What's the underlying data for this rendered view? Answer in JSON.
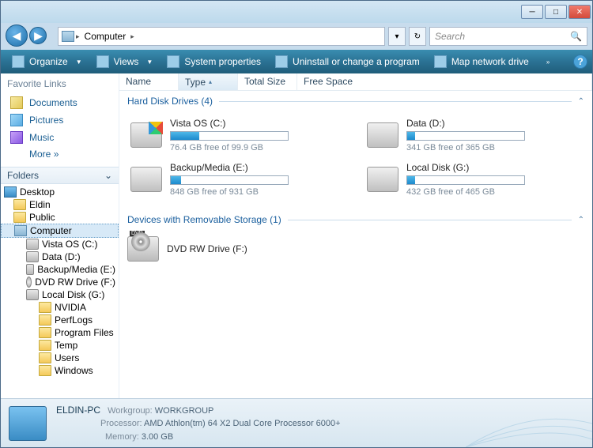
{
  "search": {
    "placeholder": "Search"
  },
  "breadcrumb": {
    "root_icon": "computer-icon",
    "items": [
      "Computer"
    ]
  },
  "toolbar": {
    "organize": "Organize",
    "views": "Views",
    "sys_props": "System properties",
    "uninstall": "Uninstall or change a program",
    "map_drive": "Map network drive"
  },
  "sidebar": {
    "fav_title": "Favorite Links",
    "favorites": [
      {
        "label": "Documents",
        "icon": "fav-docs"
      },
      {
        "label": "Pictures",
        "icon": "fav-pics"
      },
      {
        "label": "Music",
        "icon": "fav-music"
      }
    ],
    "more": "More",
    "folders_title": "Folders",
    "tree": [
      {
        "label": "Desktop",
        "icon": "ico-desktop",
        "indent": 0
      },
      {
        "label": "Eldin",
        "icon": "ico-folder",
        "indent": 1
      },
      {
        "label": "Public",
        "icon": "ico-folder",
        "indent": 1
      },
      {
        "label": "Computer",
        "icon": "ico-computer",
        "indent": 1,
        "selected": true
      },
      {
        "label": "Vista OS (C:)",
        "icon": "ico-drive",
        "indent": 2
      },
      {
        "label": "Data (D:)",
        "icon": "ico-drive",
        "indent": 2
      },
      {
        "label": "Backup/Media (E:)",
        "icon": "ico-drive",
        "indent": 2
      },
      {
        "label": "DVD RW Drive (F:)",
        "icon": "ico-dvd",
        "indent": 2
      },
      {
        "label": "Local Disk (G:)",
        "icon": "ico-drive",
        "indent": 2
      },
      {
        "label": "NVIDIA",
        "icon": "ico-folder",
        "indent": 3
      },
      {
        "label": "PerfLogs",
        "icon": "ico-folder",
        "indent": 3
      },
      {
        "label": "Program Files",
        "icon": "ico-folder",
        "indent": 3
      },
      {
        "label": "Temp",
        "icon": "ico-folder",
        "indent": 3
      },
      {
        "label": "Users",
        "icon": "ico-folder",
        "indent": 3
      },
      {
        "label": "Windows",
        "icon": "ico-folder",
        "indent": 3
      }
    ]
  },
  "columns": {
    "name": "Name",
    "type": "Type",
    "total": "Total Size",
    "free": "Free Space"
  },
  "groups": {
    "hdd_title": "Hard Disk Drives (4)",
    "removable_title": "Devices with Removable Storage (1)"
  },
  "drives": [
    {
      "name": "Vista OS (C:)",
      "free_text": "76.4 GB free of 99.9 GB",
      "fill_pct": 24,
      "os": true
    },
    {
      "name": "Data (D:)",
      "free_text": "341 GB free of 365 GB",
      "fill_pct": 7,
      "os": false
    },
    {
      "name": "Backup/Media (E:)",
      "free_text": "848 GB free of 931 GB",
      "fill_pct": 9,
      "os": false
    },
    {
      "name": "Local Disk (G:)",
      "free_text": "432 GB free of 465 GB",
      "fill_pct": 7,
      "os": false
    }
  ],
  "removable": [
    {
      "name": "DVD RW Drive (F:)"
    }
  ],
  "details": {
    "name": "ELDIN-PC",
    "workgroup_label": "Workgroup:",
    "workgroup": "WORKGROUP",
    "processor_label": "Processor:",
    "processor": "AMD Athlon(tm) 64 X2 Dual Core Processor 6000+",
    "memory_label": "Memory:",
    "memory": "3.00 GB"
  }
}
